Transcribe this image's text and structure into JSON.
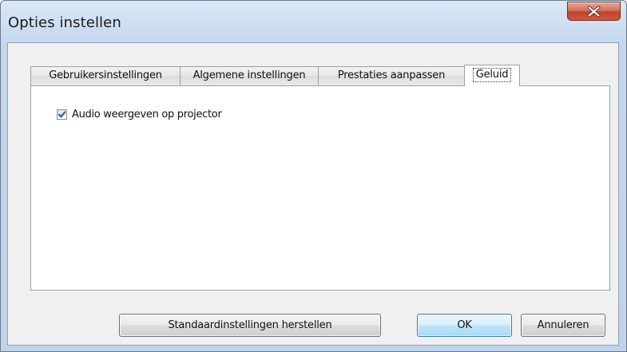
{
  "window": {
    "title": "Opties instellen",
    "close_icon": "close-icon"
  },
  "tabs": [
    {
      "label": "Gebruikersinstellingen",
      "active": false
    },
    {
      "label": "Algemene instellingen",
      "active": false
    },
    {
      "label": "Prestaties aanpassen",
      "active": false
    },
    {
      "label": "Geluid",
      "active": true
    }
  ],
  "sound": {
    "audio_checkbox": {
      "label": "Audio weergeven op projector",
      "checked": true
    }
  },
  "buttons": {
    "restore_defaults": "Standaardinstellingen herstellen",
    "ok": "OK",
    "cancel": "Annuleren"
  },
  "colors": {
    "close_button": "#c2432b",
    "default_button_border": "#3c7fb1",
    "checkmark": "#2d5fa8"
  }
}
